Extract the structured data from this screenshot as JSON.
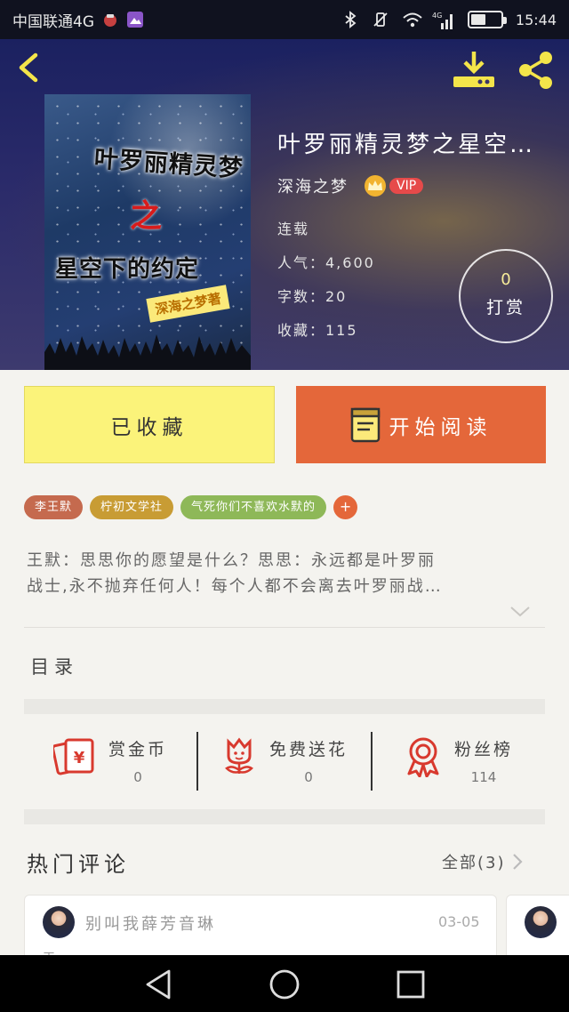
{
  "status_bar": {
    "carrier": "中国联通4G",
    "network": "4G",
    "time": "15:44",
    "battery_level": 0.5
  },
  "header": {
    "back_icon": "chevron-left-icon",
    "download_icon": "download-icon",
    "share_icon": "share-icon"
  },
  "cover": {
    "line1": "叶罗丽精灵梦",
    "line2": "之",
    "line3": "星空下的约定",
    "tag": "深海之梦著"
  },
  "book": {
    "title": "叶罗丽精灵梦之星空…",
    "author": "深海之梦",
    "vip_label": "VIP",
    "status": "连载",
    "popularity": "人气：4,600",
    "word_count": "字数：20",
    "favorites": "收藏：115",
    "reward_count": "0",
    "reward_label": "打赏"
  },
  "actions": {
    "collected_label": "已收藏",
    "read_label": "开始阅读"
  },
  "tags": [
    {
      "label": "李王默",
      "color": "#c56a4e"
    },
    {
      "label": "柠初文学社",
      "color": "#c89c34"
    },
    {
      "label": "气死你们不喜欢水默的",
      "color": "#8eb858"
    }
  ],
  "tag_add_label": "+",
  "synopsis": {
    "line1": "王默：思思你的愿望是什么？思思：永远都是叶罗丽",
    "line2": "战士,永不抛弃任何人！每个人都不会离去叶罗丽战…"
  },
  "toc_label": "目录",
  "stats": [
    {
      "label": "赏金币",
      "value": "0",
      "icon": "coin-envelope-icon"
    },
    {
      "label": "免费送花",
      "value": "0",
      "icon": "flower-icon"
    },
    {
      "label": "粉丝榜",
      "value": "114",
      "icon": "ribbon-medal-icon"
    }
  ],
  "comments_section": {
    "title": "热门评论",
    "all_label": "全部(3)"
  },
  "comments": [
    {
      "name": "别叫我薛芳音琳",
      "date": "03-05",
      "snippet": "王…"
    }
  ],
  "colors": {
    "accent_orange": "#e4673a",
    "collected_yellow": "#fbf37a",
    "reward_gold": "#f7ec9a"
  }
}
